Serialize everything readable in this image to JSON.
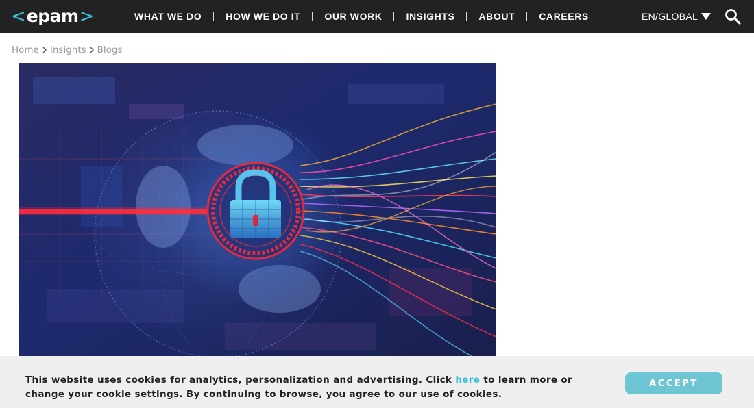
{
  "header": {
    "logo": {
      "bracket_left": "<",
      "text": "epam",
      "bracket_right": ">"
    },
    "nav": [
      {
        "label": "WHAT WE DO"
      },
      {
        "label": "HOW WE DO IT"
      },
      {
        "label": "OUR WORK"
      },
      {
        "label": "INSIGHTS"
      },
      {
        "label": "ABOUT"
      },
      {
        "label": "CAREERS"
      }
    ],
    "language": "EN/GLOBAL",
    "icons": {
      "search": "search-icon",
      "language_caret": "caret-down-icon"
    }
  },
  "breadcrumb": {
    "items": [
      "Home",
      "Insights",
      "Blogs"
    ]
  },
  "hero": {
    "icon": "padlock-icon"
  },
  "cookie_banner": {
    "text_before": "This website uses cookies for analytics, personalization and advertising. Click ",
    "link_text": "here",
    "text_after": " to learn more or change your cookie settings. By continuing to browse, you agree to our use of cookies.",
    "accept_label": "ACCEPT"
  },
  "colors": {
    "header_bg": "#222222",
    "accent": "#39c2d7",
    "accept_button": "#6ec6d4",
    "banner_bg": "#efefef",
    "lock_ring": "#e8283c"
  }
}
